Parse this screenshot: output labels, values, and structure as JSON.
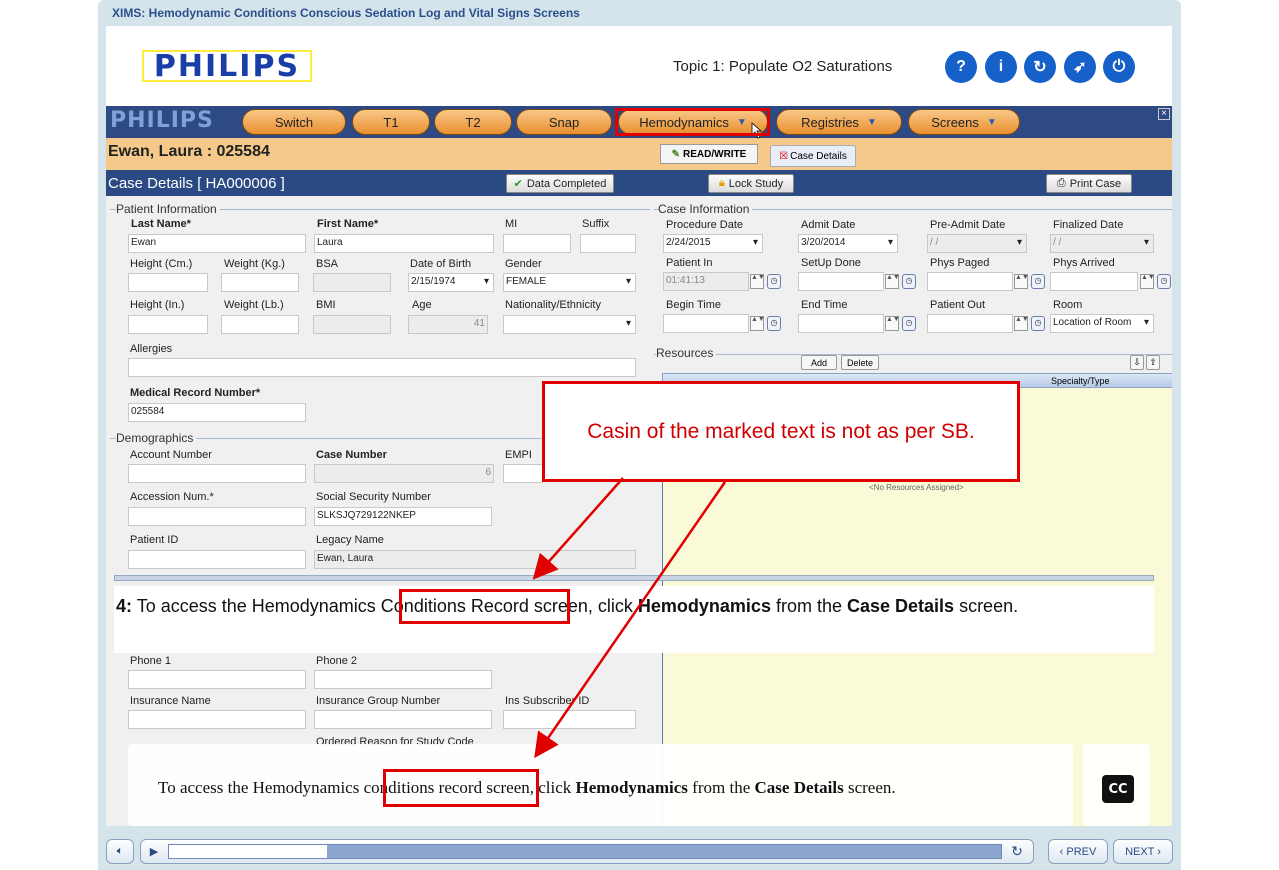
{
  "course": {
    "title": "XIMS: Hemodynamic Conditions Conscious Sedation Log and Vital Signs Screens"
  },
  "header": {
    "logo": "PHILIPS",
    "topic": "Topic 1: Populate O2 Saturations",
    "buttons": [
      {
        "name": "help",
        "glyph": "?"
      },
      {
        "name": "info",
        "glyph": "i"
      },
      {
        "name": "replay",
        "glyph": "↻"
      },
      {
        "name": "compass",
        "glyph": "➶"
      },
      {
        "name": "power",
        "glyph": "⏻"
      }
    ]
  },
  "app": {
    "logo": "PHILIPS",
    "menu": {
      "switch": "Switch",
      "t1": "T1",
      "t2": "T2",
      "snap": "Snap",
      "hemodynamics": "Hemodynamics",
      "registries": "Registries",
      "screens": "Screens"
    },
    "patient": {
      "name": "Ewan, Laura   : 025584"
    },
    "read_write": "READ/WRITE",
    "case_details_tab": "Case Details",
    "case_title": "Case Details [ HA000006 ]",
    "data_completed": "Data Completed",
    "lock_study": "Lock Study",
    "print_case": "Print Case"
  },
  "patient_info": {
    "section": "Patient Information",
    "last_name_label": "Last Name*",
    "last_name": "Ewan",
    "first_name_label": "First Name*",
    "first_name": "Laura",
    "mi_label": "MI",
    "suffix_label": "Suffix",
    "height_cm_label": "Height (Cm.)",
    "weight_kg_label": "Weight (Kg.)",
    "bsa_label": "BSA",
    "dob_label": "Date of Birth",
    "dob": "2/15/1974",
    "gender_label": "Gender",
    "gender": "FEMALE",
    "height_in_label": "Height (In.)",
    "weight_lb_label": "Weight (Lb.)",
    "bmi_label": "BMI",
    "age_label": "Age",
    "age": "41",
    "nationality_label": "Nationality/Ethnicity",
    "allergies_label": "Allergies",
    "mrn_label": "Medical Record Number*",
    "mrn": "025584"
  },
  "demographics": {
    "section": "Demographics",
    "account_label": "Account Number",
    "case_number_label": "Case Number",
    "case_number": "6",
    "empi_label": "EMPI",
    "accession_label": "Accession Num.*",
    "ssn_label": "Social Security Number",
    "ssn": "SLKSJQ729122NKEP",
    "patient_id_label": "Patient ID",
    "legacy_label": "Legacy Name",
    "legacy": "Ewan, Laura",
    "phone1_label": "Phone 1",
    "phone2_label": "Phone 2",
    "insurance_label": "Insurance Name",
    "ins_group_label": "Insurance Group Number",
    "ins_sub_label": "Ins Subscriber ID",
    "ordered_reason_label": "Ordered Reason for Study Code"
  },
  "case_info": {
    "section": "Case Information",
    "procedure_date_label": "Procedure Date",
    "procedure_date": "2/24/2015",
    "admit_date_label": "Admit Date",
    "admit_date": "3/20/2014",
    "pre_admit_label": "Pre-Admit Date",
    "pre_admit": "/ /",
    "finalized_label": "Finalized Date",
    "finalized": "/ /",
    "patient_in_label": "Patient In",
    "patient_in": "01:41:13",
    "setup_label": "SetUp Done",
    "phys_paged_label": "Phys Paged",
    "phys_arrived_label": "Phys Arrived",
    "begin_label": "Begin Time",
    "end_label": "End Time",
    "patient_out_label": "Patient Out",
    "room_label": "Room",
    "room": "Location of Room"
  },
  "resources": {
    "section": "Resources",
    "add": "Add",
    "delete": "Delete",
    "col_specialty": "Specialty/Type",
    "empty": "<No Resources Assigned>"
  },
  "annotation": {
    "text": "Casin of the marked text is not as per SB."
  },
  "step": {
    "num": "4:",
    "t1": " To access the Hemodynamics ",
    "t2": "Conditions Record",
    "t3": " screen, click ",
    "t4": "Hemodynamics",
    "t5": " from the ",
    "t6": "Case Details",
    "t7": " screen."
  },
  "closed_caption": {
    "t1": "To access the Hemodynamics ",
    "t2": "conditions record",
    "t3": " screen, click ",
    "t4": "Hemodynamics",
    "t5": " from the ",
    "t6": "Case Details",
    "t7": " screen.",
    "cc_button": "CC"
  },
  "player": {
    "prev": "‹ PREV",
    "next": "NEXT ›",
    "progress": 0.19
  }
}
